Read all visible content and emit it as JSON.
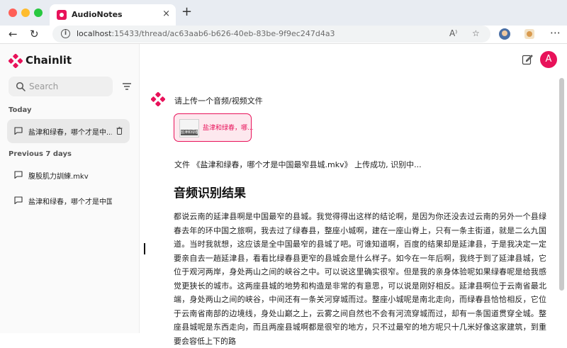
{
  "browser": {
    "tab_title": "AudioNotes",
    "new_tab_symbol": "+",
    "url_host": "localhost",
    "url_rest": ":15433/thread/ac63aab6-b626-40eb-83be-9f9ec247d4a3",
    "reader_icon_text": "A⁾"
  },
  "sidebar": {
    "brand": "Chainlit",
    "search_placeholder": "Search",
    "today_label": "Today",
    "today_items": [
      {
        "label": "盐津和绿春，哪个才是中..."
      }
    ],
    "previous_label": "Previous 7 days",
    "previous_items": [
      {
        "label": "腹股肌力訓練.mkv"
      },
      {
        "label": "盐津和绿春，哪个才是中国..."
      }
    ]
  },
  "header": {
    "avatar_initial": "A"
  },
  "chat": {
    "prompt": "请上传一个音频/视频文件",
    "file_name": "盐津和绿春，哪...",
    "file_thumb_label": "盐津和绿春",
    "upload_status": "文件 《盐津和绿春，哪个才是中国最窄县城.mkv》 上传成功, 识别中...",
    "result_title": "音频识别结果",
    "transcript": "都说云南的延津县啊是中国最窄的县城。我觉得得出这样的结论啊，是因为你还没去过云南的另外一个县绿春去年的环中国之旅啊，我去过了绿春县，整座小城啊，建在一座山脊上，只有一条主街道，就是二么九国道。当时我就想，这应该是全中国最窄的县城了吧。可谁知道啊，百度的结果却是延津县，于是我决定一定要亲自去一趟延津县，看看比绿春县更窄的县城会是什么样子。如今在一年后啊，我终于到了延津县城，它位于观河两岸，身处两山之间的峡谷之中。可以说这里确实很窄。但是我的亲身体验呢如果绿春呢是给我感觉更狭长的城市。这两座县城的地势和构造是非常的有意思，可以说是刚好相反。延津县啊位于云南省最北端，身处两山之间的峡谷，中间还有一条关河穿城而过。整座小城呢是南北走向，而绿春县恰恰相反，它位于云南省南部的边境线，身处山巅之上，云雾之间自然也不会有河流穿城而过，却有一条国道贯穿全城。整座县城呢是东西走向，而且两座县城啊都是很窄的地方，只不过最窄的地方呢只十几米好像这家建筑，到重要会容低上下的路"
  },
  "colors": {
    "accent": "#e8125a",
    "accent_soft": "#fde8ee"
  }
}
